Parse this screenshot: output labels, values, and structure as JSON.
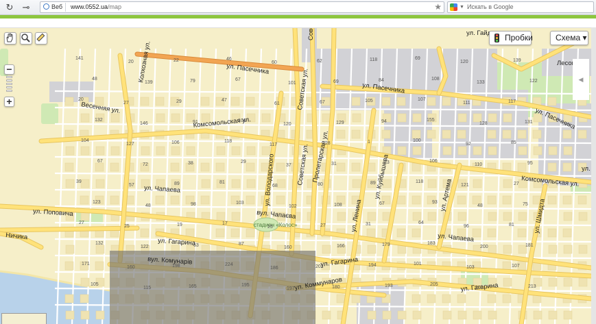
{
  "browser": {
    "site_label": "Веб",
    "url_host": "www.0552.ua",
    "url_path": "/map",
    "search_placeholder": "Искать в Google"
  },
  "map_controls": {
    "traffic_label": "Пробки",
    "layer_label": "Схема ▾",
    "zoom_in": "+",
    "zoom_out": "−"
  },
  "colors": {
    "land": "#f6efc9",
    "road": "#ffffff",
    "main_road": "#ffe27a",
    "highway": "#f2a553",
    "industrial": "#d2d2d6",
    "park": "#cfe9b4",
    "water": "#b8d2ea",
    "highlight": "#6e6e6e"
  },
  "streets": [
    "ул. Пасечника",
    "ул. Пасечника",
    "ул. Пасечника",
    "ул. Гайдара",
    "Лесопа",
    "Колхозная ул.",
    "Весенняя ул.",
    "Комсомольская ул.",
    "Комсомольская ул.",
    "Советская",
    "Советская ул.",
    "Советская ул.",
    "Пролетарская ул.",
    "ул. Володарского",
    "ул. Чапаева",
    "вул. Чапаєва",
    "ул. Чапаева",
    "ул. Поповича",
    "Ничика",
    "ул. Гагарина",
    "ул. Гагарина",
    "ул. Гагарина",
    "вул. Комунарів",
    "ул. Коммунаров",
    "ул. Ленина",
    "ул. Куйбышева",
    "ул. Артема",
    "ул. Шмидта",
    "ул. Ка",
    "стадион «Колос»"
  ],
  "house_numbers": [
    "141",
    "20",
    "22",
    "46",
    "60",
    "62",
    "118",
    "69",
    "120",
    "139",
    "48",
    "139",
    "79",
    "67",
    "101",
    "69",
    "84",
    "108",
    "133",
    "122",
    "20",
    "27",
    "29",
    "47",
    "61",
    "67",
    "105",
    "107",
    "111",
    "117",
    "132",
    "146",
    "91",
    "106",
    "120",
    "129",
    "94",
    "155",
    "128",
    "131",
    "104",
    "127",
    "106",
    "118",
    "117",
    "128",
    "1",
    "100",
    "92",
    "85",
    "67",
    "72",
    "38",
    "29",
    "37",
    "31",
    "73",
    "106",
    "110",
    "95",
    "39",
    "57",
    "89",
    "81",
    "68",
    "80",
    "89",
    "118",
    "121",
    "27",
    "123",
    "48",
    "98",
    "103",
    "102",
    "108",
    "67",
    "93",
    "48",
    "75",
    "27",
    "25",
    "19",
    "17",
    "25",
    "27",
    "31",
    "64",
    "96",
    "81",
    "132",
    "122",
    "63",
    "87",
    "160",
    "166",
    "179",
    "183",
    "200",
    "181",
    "171",
    "160",
    "198",
    "224",
    "186",
    "202",
    "194",
    "101",
    "103",
    "107",
    "105",
    "115",
    "165",
    "195",
    "197",
    "180",
    "193",
    "205",
    "208",
    "213"
  ]
}
